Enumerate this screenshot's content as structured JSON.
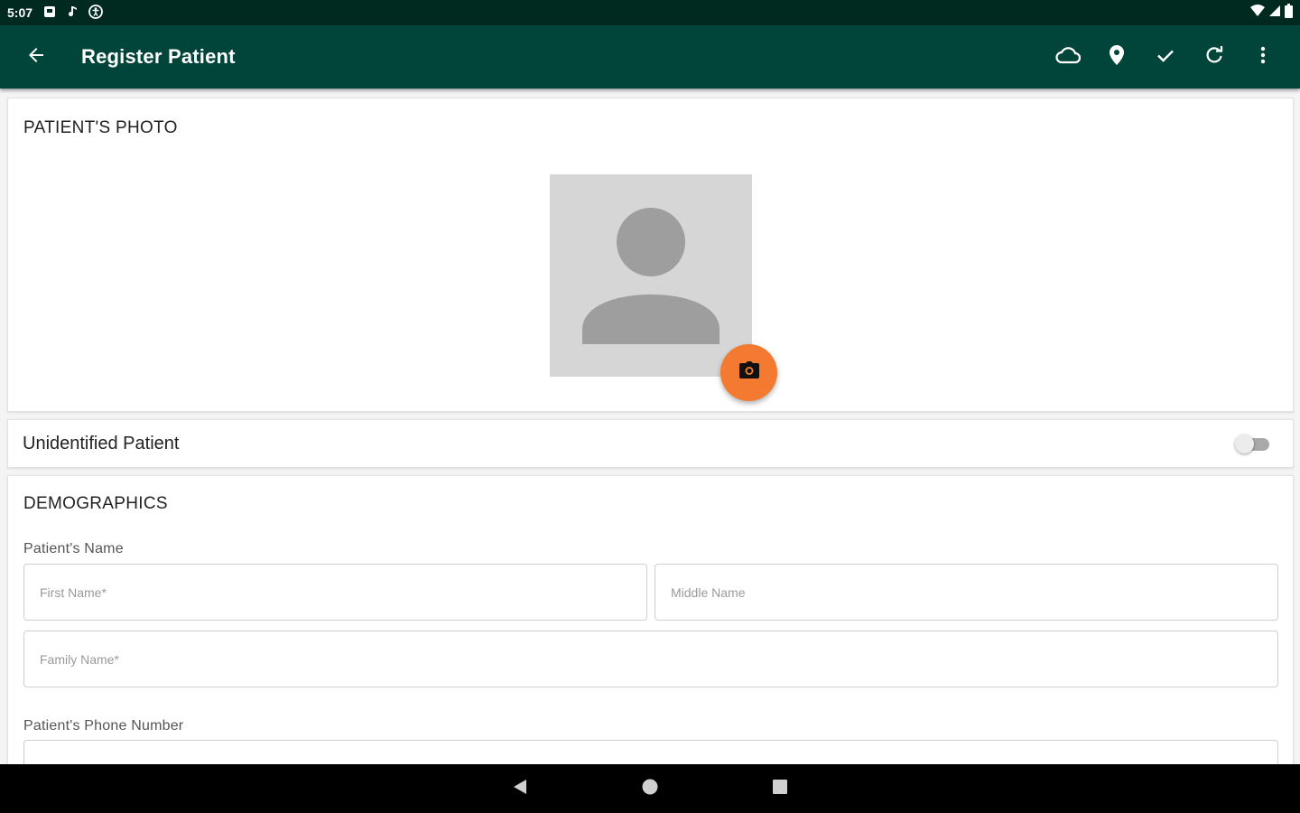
{
  "status_bar": {
    "time": "5:07",
    "icons": [
      "notification-square-icon",
      "music-note-icon",
      "accessibility-icon"
    ],
    "right_icons": [
      "wifi-icon",
      "signal-icon",
      "battery-icon"
    ]
  },
  "app_bar": {
    "title": "Register Patient",
    "actions": [
      "cloud-icon",
      "location-pin-icon",
      "check-icon",
      "refresh-icon",
      "more-vert-icon"
    ]
  },
  "photo_section": {
    "title": "PATIENT'S PHOTO"
  },
  "unidentified": {
    "label": "Unidentified Patient",
    "on": false
  },
  "demographics": {
    "title": "DEMOGRAPHICS",
    "name_label": "Patient's Name",
    "first_name_placeholder": "First Name*",
    "middle_name_placeholder": "Middle Name",
    "family_name_placeholder": "Family Name*",
    "phone_label": "Patient's Phone Number"
  },
  "colors": {
    "status_bar": "#00291f",
    "app_bar": "#01453a",
    "fab": "#f37a30"
  }
}
